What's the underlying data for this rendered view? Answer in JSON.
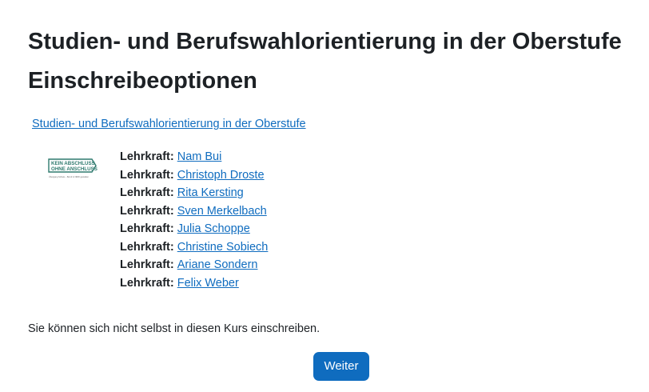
{
  "page_title": "Studien- und Berufswahlorientierung in der Oberstufe",
  "section_title": "Einschreibeoptionen",
  "course": {
    "link_text": "Studien- und Berufswahlorientierung in der Oberstufe",
    "logo": {
      "icon": "kaoa-logo-icon",
      "line1": "KEIN ABSCHLUSS",
      "line2": "OHNE ANSCHLUSS",
      "tagline": "Übergang Schule – Beruf in NRW gestalten",
      "color": "#2f7a6e"
    },
    "teachers": [
      {
        "role": "Lehrkraft",
        "name": "Nam Bui"
      },
      {
        "role": "Lehrkraft",
        "name": "Christoph Droste"
      },
      {
        "role": "Lehrkraft",
        "name": "Rita Kersting"
      },
      {
        "role": "Lehrkraft",
        "name": "Sven Merkelbach"
      },
      {
        "role": "Lehrkraft",
        "name": "Julia Schoppe"
      },
      {
        "role": "Lehrkraft",
        "name": "Christine Sobiech"
      },
      {
        "role": "Lehrkraft",
        "name": "Ariane Sondern"
      },
      {
        "role": "Lehrkraft",
        "name": "Felix Weber"
      }
    ]
  },
  "notice": "Sie können sich nicht selbst in diesen Kurs einschreiben.",
  "continue_button": "Weiter",
  "colors": {
    "link": "#0f6cbf",
    "primary_button": "#0f6cbf",
    "text": "#1d2125"
  }
}
